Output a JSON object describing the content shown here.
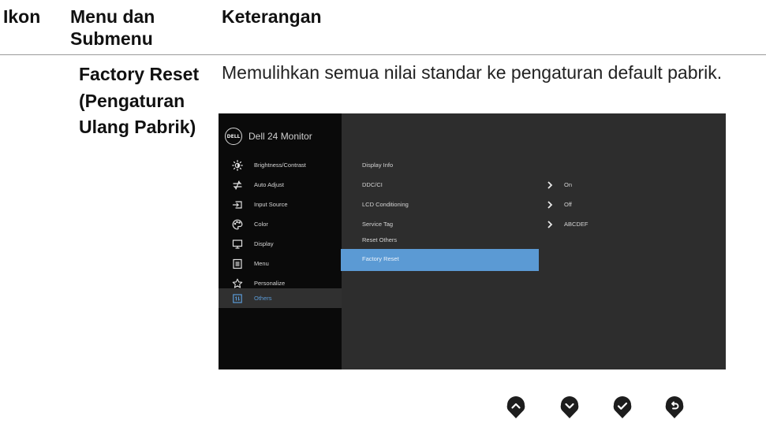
{
  "headers": {
    "icon": "Ikon",
    "menu": "Menu dan Submenu",
    "description": "Keterangan"
  },
  "item": {
    "title": "Factory Reset (Pengaturan Ulang Pabrik)",
    "description": "Memulihkan semua nilai standar ke pengaturan default pabrik."
  },
  "osd": {
    "brand_logo": "DELL",
    "monitor_name": "Dell 24 Monitor",
    "menu": [
      {
        "label": "Brightness/Contrast",
        "icon": "brightness-icon"
      },
      {
        "label": "Auto Adjust",
        "icon": "auto-adjust-icon"
      },
      {
        "label": "Input Source",
        "icon": "input-source-icon"
      },
      {
        "label": "Color",
        "icon": "color-palette-icon"
      },
      {
        "label": "Display",
        "icon": "display-icon"
      },
      {
        "label": "Menu",
        "icon": "menu-icon"
      },
      {
        "label": "Personalize",
        "icon": "star-icon"
      },
      {
        "label": "Others",
        "icon": "others-icon",
        "active": true
      }
    ],
    "submenu": [
      {
        "label": "Display Info"
      },
      {
        "label": "DDC/CI",
        "value": "On"
      },
      {
        "label": "LCD Conditioning",
        "value": "Off"
      },
      {
        "label": "Service Tag",
        "value": "ABCDEF"
      },
      {
        "label": "Reset Others"
      },
      {
        "label": "Factory Reset",
        "selected": true
      }
    ]
  },
  "nav_buttons": [
    "up-icon",
    "down-icon",
    "check-icon",
    "back-icon"
  ],
  "colors": {
    "highlight": "#5b9ad4",
    "active_text": "#5a9ad6",
    "osd_panel": "#2d2d2d",
    "osd_sidebar": "#0a0a0a"
  }
}
